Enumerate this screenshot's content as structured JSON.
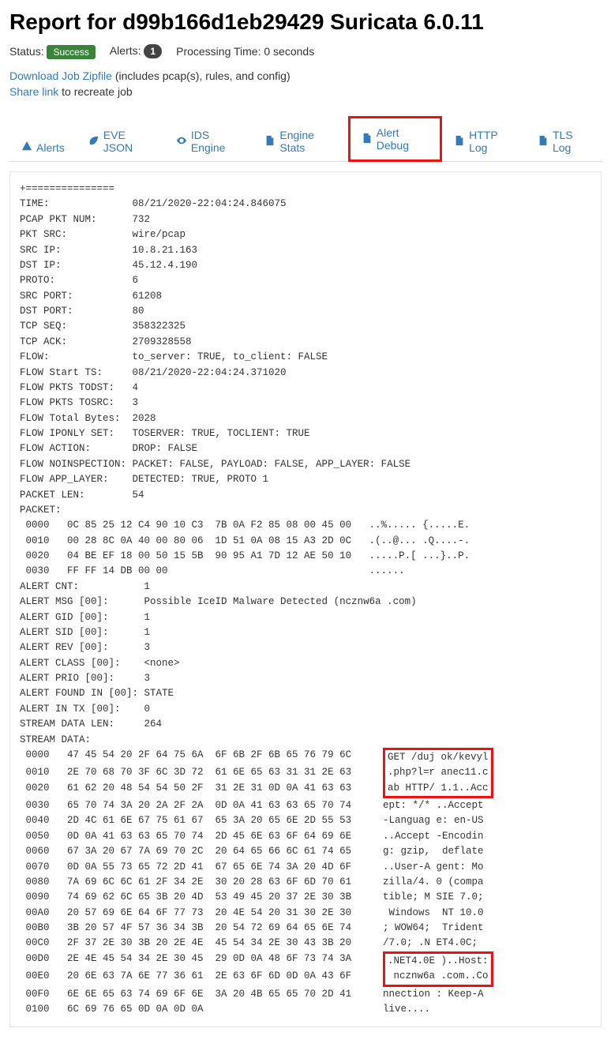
{
  "title": "Report for d99b166d1eb29429 Suricata 6.0.11",
  "status": {
    "status_label": "Status:",
    "success_badge": "Success",
    "alerts_label": "Alerts:",
    "alerts_count": "1",
    "processing_label": "Processing Time: 0 seconds"
  },
  "links": {
    "download": "Download Job Zipfile",
    "download_suffix": " (includes pcap(s), rules, and config)",
    "share": "Share link",
    "share_suffix": " to recreate job"
  },
  "tabs": {
    "alerts": "Alerts",
    "eve": "EVE JSON",
    "ids": "IDS Engine",
    "stats": "Engine Stats",
    "debug": "Alert Debug",
    "http": "HTTP Log",
    "tls": "TLS Log"
  },
  "report": {
    "sep": "+===============",
    "rows": [
      {
        "k": "TIME:",
        "v": "08/21/2020-22:04:24.846075"
      },
      {
        "k": "PCAP PKT NUM:",
        "v": "732"
      },
      {
        "k": "PKT SRC:",
        "v": "wire/pcap"
      },
      {
        "k": "SRC IP:",
        "v": "10.8.21.163"
      },
      {
        "k": "DST IP:",
        "v": "45.12.4.190"
      },
      {
        "k": "PROTO:",
        "v": "6"
      },
      {
        "k": "SRC PORT:",
        "v": "61208"
      },
      {
        "k": "DST PORT:",
        "v": "80"
      },
      {
        "k": "TCP SEQ:",
        "v": "358322325"
      },
      {
        "k": "TCP ACK:",
        "v": "2709328558"
      },
      {
        "k": "FLOW:",
        "v": "to_server: TRUE, to_client: FALSE"
      },
      {
        "k": "FLOW Start TS:",
        "v": "08/21/2020-22:04:24.371020"
      },
      {
        "k": "FLOW PKTS TODST:",
        "v": "4"
      },
      {
        "k": "FLOW PKTS TOSRC:",
        "v": "3"
      },
      {
        "k": "FLOW Total Bytes:",
        "v": "2028"
      },
      {
        "k": "FLOW IPONLY SET:",
        "v": "TOSERVER: TRUE, TOCLIENT: TRUE"
      },
      {
        "k": "FLOW ACTION:",
        "v": "DROP: FALSE"
      },
      {
        "k": "FLOW NOINSPECTION:",
        "v": "PACKET: FALSE, PAYLOAD: FALSE, APP_LAYER: FALSE"
      },
      {
        "k": "FLOW APP_LAYER:",
        "v": "DETECTED: TRUE, PROTO 1"
      },
      {
        "k": "PACKET LEN:",
        "v": "54"
      }
    ],
    "packet_label": "PACKET:",
    "packet_hex": [
      " 0000   0C 85 25 12 C4 90 10 C3  7B 0A F2 85 08 00 45 00   ..%..... {.....E.",
      " 0010   00 28 8C 0A 40 00 80 06  1D 51 0A 08 15 A3 2D 0C   .(..@... .Q....-.",
      " 0020   04 BE EF 18 00 50 15 5B  90 95 A1 7D 12 AE 50 10   .....P.[ ...}..P.",
      " 0030   FF FF 14 DB 00 00                                  ......"
    ],
    "alert_rows": [
      {
        "k": "ALERT CNT:",
        "v": "1"
      },
      {
        "k": "ALERT MSG [00]:",
        "v": "Possible IceID Malware Detected (ncznw6a .com)"
      },
      {
        "k": "ALERT GID [00]:",
        "v": "1"
      },
      {
        "k": "ALERT SID [00]:",
        "v": "1"
      },
      {
        "k": "ALERT REV [00]:",
        "v": "3"
      },
      {
        "k": "ALERT CLASS [00]:",
        "v": "<none>"
      },
      {
        "k": "ALERT PRIO [00]:",
        "v": "3"
      },
      {
        "k": "ALERT FOUND IN [00]:",
        "v": "STATE"
      },
      {
        "k": "ALERT IN TX [00]:",
        "v": "0"
      },
      {
        "k": "STREAM DATA LEN:",
        "v": "264"
      }
    ],
    "stream_label": "STREAM DATA:",
    "stream": [
      {
        "off": " 0000",
        "hex": "47 45 54 20 2F 64 75 6A  6F 6B 2F 6B 65 76 79 6C",
        "asc": "GET /duj ok/kevyl",
        "hl": "top"
      },
      {
        "off": " 0010",
        "hex": "2E 70 68 70 3F 6C 3D 72  61 6E 65 63 31 31 2E 63",
        "asc": ".php?l=r anec11.c",
        "hl": "mid"
      },
      {
        "off": " 0020",
        "hex": "61 62 20 48 54 54 50 2F  31 2E 31 0D 0A 41 63 63",
        "asc": "ab HTTP/ 1.1..Acc",
        "hl": "bot"
      },
      {
        "off": " 0030",
        "hex": "65 70 74 3A 20 2A 2F 2A  0D 0A 41 63 63 65 70 74",
        "asc": "ept: */* ..Accept"
      },
      {
        "off": " 0040",
        "hex": "2D 4C 61 6E 67 75 61 67  65 3A 20 65 6E 2D 55 53",
        "asc": "-Languag e: en-US"
      },
      {
        "off": " 0050",
        "hex": "0D 0A 41 63 63 65 70 74  2D 45 6E 63 6F 64 69 6E",
        "asc": "..Accept -Encodin"
      },
      {
        "off": " 0060",
        "hex": "67 3A 20 67 7A 69 70 2C  20 64 65 66 6C 61 74 65",
        "asc": "g: gzip,  deflate"
      },
      {
        "off": " 0070",
        "hex": "0D 0A 55 73 65 72 2D 41  67 65 6E 74 3A 20 4D 6F",
        "asc": "..User-A gent: Mo"
      },
      {
        "off": " 0080",
        "hex": "7A 69 6C 6C 61 2F 34 2E  30 20 28 63 6F 6D 70 61",
        "asc": "zilla/4. 0 (compa"
      },
      {
        "off": " 0090",
        "hex": "74 69 62 6C 65 3B 20 4D  53 49 45 20 37 2E 30 3B",
        "asc": "tible; M SIE 7.0;"
      },
      {
        "off": " 00A0",
        "hex": "20 57 69 6E 64 6F 77 73  20 4E 54 20 31 30 2E 30",
        "asc": " Windows  NT 10.0"
      },
      {
        "off": " 00B0",
        "hex": "3B 20 57 4F 57 36 34 3B  20 54 72 69 64 65 6E 74",
        "asc": "; WOW64;  Trident"
      },
      {
        "off": " 00C0",
        "hex": "2F 37 2E 30 3B 20 2E 4E  45 54 34 2E 30 43 3B 20",
        "asc": "/7.0; .N ET4.0C; "
      },
      {
        "off": " 00D0",
        "hex": "2E 4E 45 54 34 2E 30 45  29 0D 0A 48 6F 73 74 3A",
        "asc": ".NET4.0E )..Host:",
        "hl": "top2"
      },
      {
        "off": " 00E0",
        "hex": "20 6E 63 7A 6E 77 36 61  2E 63 6F 6D 0D 0A 43 6F",
        "asc": " ncznw6a .com..Co",
        "hl": "bot2"
      },
      {
        "off": " 00F0",
        "hex": "6E 6E 65 63 74 69 6F 6E  3A 20 4B 65 65 70 2D 41",
        "asc": "nnection : Keep-A"
      },
      {
        "off": " 0100",
        "hex": "6C 69 76 65 0D 0A 0D 0A",
        "asc": "live...."
      }
    ]
  }
}
